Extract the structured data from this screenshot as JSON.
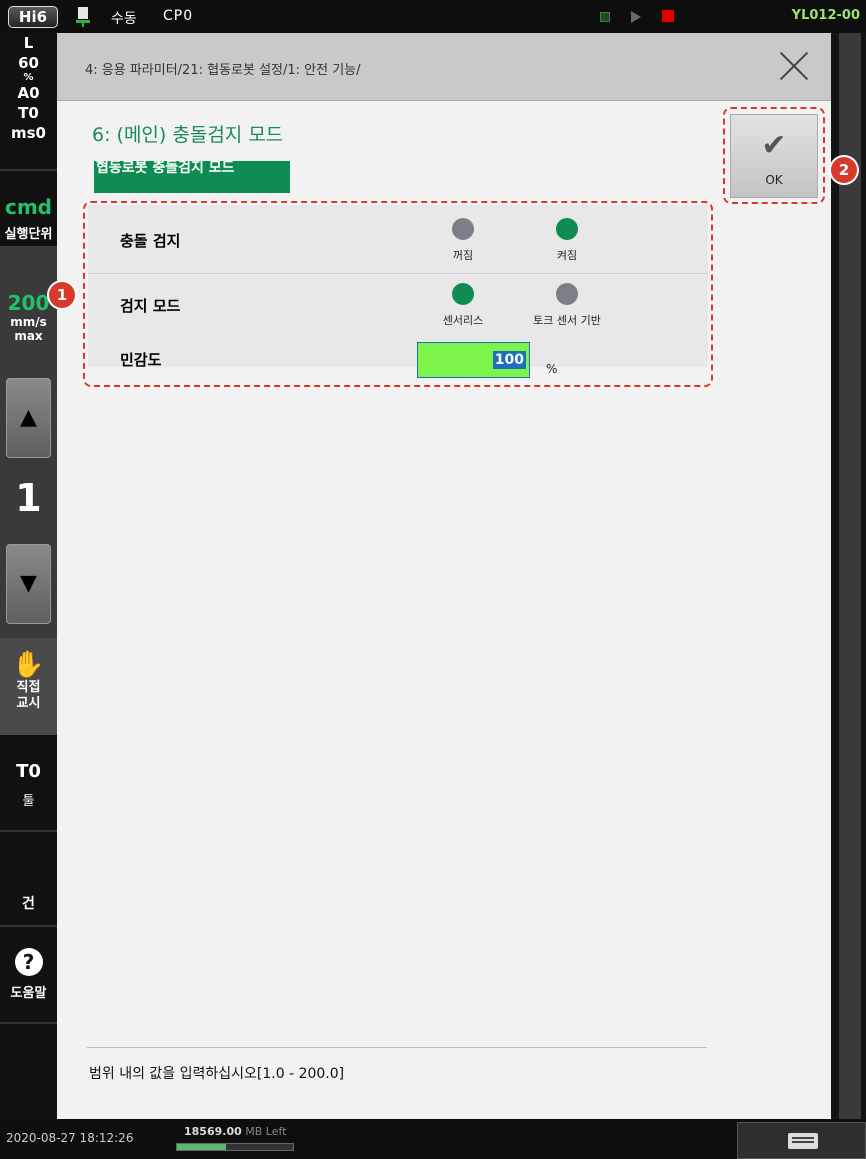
{
  "topbar": {
    "logo": "Hi6",
    "mode": "수동",
    "cp": "CP0",
    "file": "YL012-00"
  },
  "leftbar": {
    "status": [
      "L",
      "60",
      "%",
      "A0",
      "T0",
      "ms0"
    ],
    "cmd": "cmd",
    "cmd_sub": "실행단위",
    "speed": "200",
    "speed_unit": "mm/s",
    "speed_mode": "max",
    "up_arrow": "▲",
    "down_arrow": "▼",
    "step": "1",
    "teach_line1": "직접",
    "teach_line2": "교시",
    "tool": "T0",
    "tool_label": "툴",
    "gun": "건",
    "help_icon": "?",
    "help": "도움말"
  },
  "dialog": {
    "path": "4: 응용 파라미터/21: 협동로봇 설정/1: 안전 기능/",
    "title": "6: (메인) 충돌검지 모드",
    "badge": "협동로봇 충돌검지 모드",
    "rows": [
      {
        "label": "충돌 검지",
        "options": [
          {
            "label": "꺼짐",
            "selected": false
          },
          {
            "label": "켜짐",
            "selected": true
          }
        ]
      },
      {
        "label": "검지 모드",
        "options": [
          {
            "label": "센서리스",
            "selected": true
          },
          {
            "label": "토크 센서 기반",
            "selected": false
          }
        ]
      },
      {
        "label": "민감도",
        "value": "100",
        "unit": "%"
      }
    ],
    "ok": "OK",
    "hint": "범위 내의 값을 입력하십시오[1.0 - 200.0]"
  },
  "markers": {
    "m1": "1",
    "m2": "2"
  },
  "bottombar": {
    "datetime": "2020-08-27 18:12:26",
    "mem_value": "18569.00",
    "mem_label": "MB Left",
    "mem_fill": 0.42
  },
  "colors": {
    "accent": "#0e8c52",
    "input_bg": "#7cf44a",
    "marker": "#d9392b"
  }
}
